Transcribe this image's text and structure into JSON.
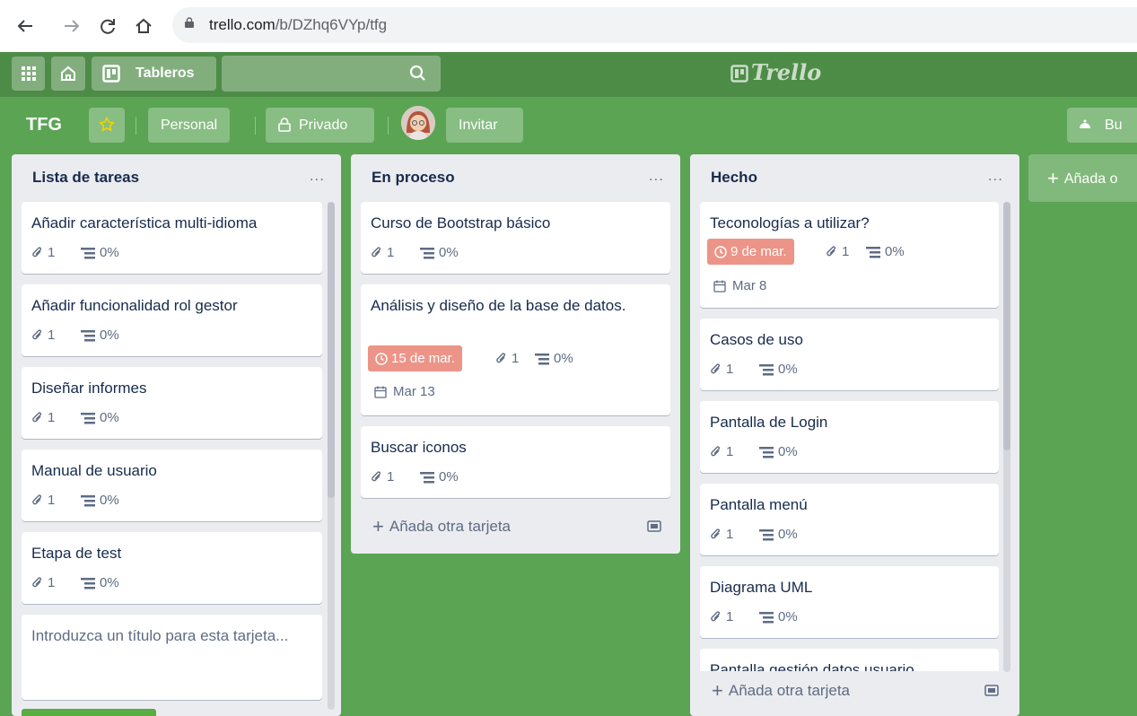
{
  "browser": {
    "url_host": "trello.com",
    "url_path": "/b/DZhq6VYp/tfg",
    "back_icon": "arrow-left-icon",
    "forward_icon": "arrow-right-icon",
    "reload_icon": "reload-icon",
    "home_icon": "home-icon"
  },
  "header": {
    "apps_icon": "grid-icon",
    "home_icon": "house-icon",
    "boards_label": "Tableros",
    "search_placeholder": "",
    "logo": "Trello"
  },
  "board": {
    "title": "TFG",
    "star_icon": "star-icon",
    "team_label": "Personal",
    "visibility_label": "Privado",
    "invite_label": "Invitar",
    "butler_label": "Bu"
  },
  "lists": [
    {
      "title": "Lista de tareas",
      "menu": "...",
      "cards": [
        {
          "title": "Añadir característica multi-idioma",
          "attachments": "1",
          "checklist": "0%"
        },
        {
          "title": "Añadir funcionalidad rol gestor",
          "attachments": "1",
          "checklist": "0%"
        },
        {
          "title": "Diseñar informes",
          "attachments": "1",
          "checklist": "0%"
        },
        {
          "title": "Manual de usuario",
          "attachments": "1",
          "checklist": "0%"
        },
        {
          "title": "Etapa de test",
          "attachments": "1",
          "checklist": "0%"
        }
      ],
      "composer_placeholder": "Introduzca un título para esta tarjeta..."
    },
    {
      "title": "En proceso",
      "menu": "...",
      "cards": [
        {
          "title": "Curso de Bootstrap básico",
          "attachments": "1",
          "checklist": "0%"
        },
        {
          "title": "Análisis y diseño de la base de datos.",
          "due": "15 de mar.",
          "attachments": "1",
          "checklist": "0%",
          "date": "Mar 13"
        },
        {
          "title": "Buscar iconos",
          "attachments": "1",
          "checklist": "0%"
        }
      ],
      "add_card": "Añada otra tarjeta"
    },
    {
      "title": "Hecho",
      "menu": "...",
      "cards": [
        {
          "title": "Teconologías a utilizar?",
          "due": "9 de mar.",
          "attachments": "1",
          "checklist": "0%",
          "date": "Mar 8"
        },
        {
          "title": "Casos de uso",
          "attachments": "1",
          "checklist": "0%"
        },
        {
          "title": "Pantalla de Login",
          "attachments": "1",
          "checklist": "0%"
        },
        {
          "title": "Pantalla menú",
          "attachments": "1",
          "checklist": "0%"
        },
        {
          "title": "Diagrama UML",
          "attachments": "1",
          "checklist": "0%"
        },
        {
          "title": "Pantalla gestión datos usuario"
        }
      ],
      "add_card": "Añada otra tarjeta"
    }
  ],
  "add_list": "Añada o",
  "colors": {
    "board_bg": "#5aa454",
    "header_bg": "#4d8c47",
    "due_badge": "#ec9488",
    "list_bg": "#ebecf0",
    "add_button": "#5aac44"
  }
}
